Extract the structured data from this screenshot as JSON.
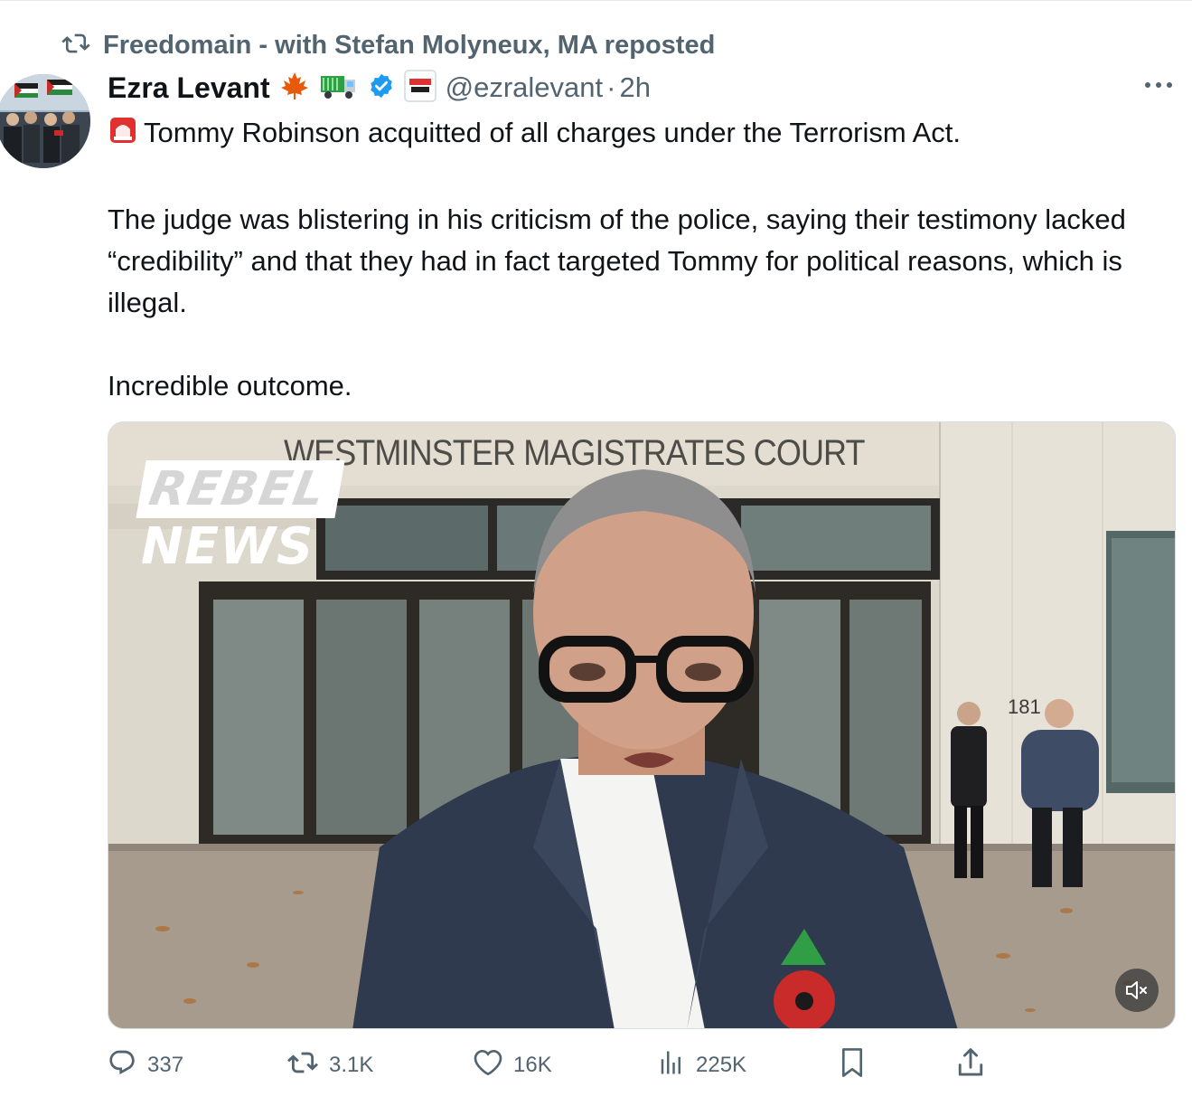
{
  "repost": {
    "label": "Freedomain - with Stefan Molyneux, MA reposted",
    "icon": "repost-icon"
  },
  "tweet": {
    "author_name": "Ezra Levant",
    "name_emojis": [
      "maple-leaf-emoji",
      "truck-emoji"
    ],
    "verified_icon": "verified-badge-icon",
    "affiliate_badge": "rebel-news-badge",
    "handle": "@ezralevant",
    "separator": "·",
    "time": "2h",
    "text_line1": "Tommy Robinson acquitted of all charges under the Terrorism Act.",
    "text_para2": "The judge was blistering in his criticism of the police, saying their testimony lacked “credibility” and that they had in fact targeted Tommy for political reasons, which is illegal.",
    "text_para3": "Incredible outcome.",
    "siren_icon": "police-light-emoji"
  },
  "media": {
    "sign_text": "WESTMINSTER MAGISTRATES COURT",
    "logo_top": "REBEL",
    "logo_bottom": "NEWS",
    "address_number": "181",
    "mute_icon": "volume-muted-icon"
  },
  "actions": {
    "replies": "337",
    "reposts": "3.1K",
    "likes": "16K",
    "views": "225K"
  },
  "colors": {
    "text_primary": "#0f1419",
    "text_secondary": "#536471",
    "verified": "#1d9bf0"
  }
}
